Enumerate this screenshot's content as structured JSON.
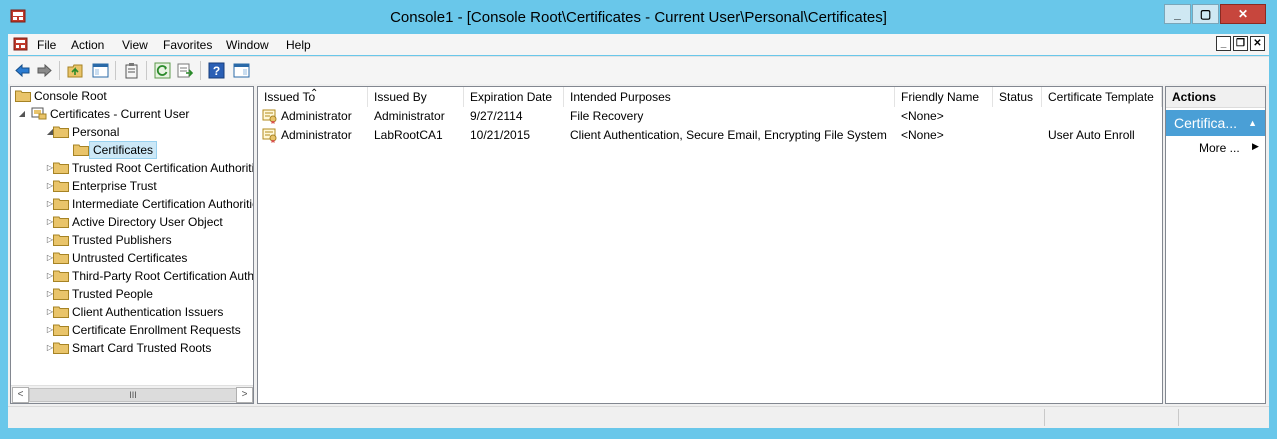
{
  "window": {
    "title": "Console1 - [Console Root\\Certificates - Current User\\Personal\\Certificates]",
    "buttons": {
      "minimize": "_",
      "maximize": "▢",
      "close": "✕"
    }
  },
  "menu": {
    "items": [
      "File",
      "Action",
      "View",
      "Favorites",
      "Window",
      "Help"
    ],
    "mdi": {
      "minimize": "_",
      "restore": "❐",
      "close": "✕"
    }
  },
  "toolbar": {
    "icons": [
      "back-icon",
      "forward-icon",
      "up-folder-icon",
      "show-hide-tree-icon",
      "clipboard-icon",
      "refresh-icon",
      "export-list-icon",
      "help-icon",
      "show-hide-action-pane-icon"
    ]
  },
  "tree": {
    "items": [
      {
        "label": "Console Root",
        "level": 0,
        "expander": ""
      },
      {
        "label": "Certificates - Current User",
        "level": 1,
        "expander": "◢"
      },
      {
        "label": "Personal",
        "level": 2,
        "expander": "◢"
      },
      {
        "label": "Certificates",
        "level": 3,
        "expander": "",
        "selected": true
      },
      {
        "label": "Trusted Root Certification Authorities",
        "level": 2,
        "expander": "▷"
      },
      {
        "label": "Enterprise Trust",
        "level": 2,
        "expander": "▷"
      },
      {
        "label": "Intermediate Certification Authorities",
        "level": 2,
        "expander": "▷"
      },
      {
        "label": "Active Directory User Object",
        "level": 2,
        "expander": "▷"
      },
      {
        "label": "Trusted Publishers",
        "level": 2,
        "expander": "▷"
      },
      {
        "label": "Untrusted Certificates",
        "level": 2,
        "expander": "▷"
      },
      {
        "label": "Third-Party Root Certification Authorities",
        "level": 2,
        "expander": "▷"
      },
      {
        "label": "Trusted People",
        "level": 2,
        "expander": "▷"
      },
      {
        "label": "Client Authentication Issuers",
        "level": 2,
        "expander": "▷"
      },
      {
        "label": "Certificate Enrollment Requests",
        "level": 2,
        "expander": "▷"
      },
      {
        "label": "Smart Card Trusted Roots",
        "level": 2,
        "expander": "▷"
      }
    ],
    "scroll": {
      "left": "<",
      "thumb": "III",
      "right": ">"
    }
  },
  "list": {
    "columns": [
      "Issued To",
      "Issued By",
      "Expiration Date",
      "Intended Purposes",
      "Friendly Name",
      "Status",
      "Certificate Template"
    ],
    "sort_indicator": "⌃",
    "rows": [
      [
        "Administrator",
        "Administrator",
        "9/27/2114",
        "File Recovery",
        "<None>",
        "",
        ""
      ],
      [
        "Administrator",
        "LabRootCA1",
        "10/21/2015",
        "Client Authentication, Secure Email, Encrypting File System",
        "<None>",
        "",
        "User Auto Enroll"
      ]
    ]
  },
  "actions": {
    "header": "Actions",
    "section": "Certifica...",
    "section_caret": "▲",
    "more": "More ...",
    "more_arrow": "▶"
  },
  "colors": {
    "titlebar": "#69c7ea",
    "selection": "#4a9fd6",
    "close_button": "#c7463d",
    "folder": "#e9c46a"
  }
}
